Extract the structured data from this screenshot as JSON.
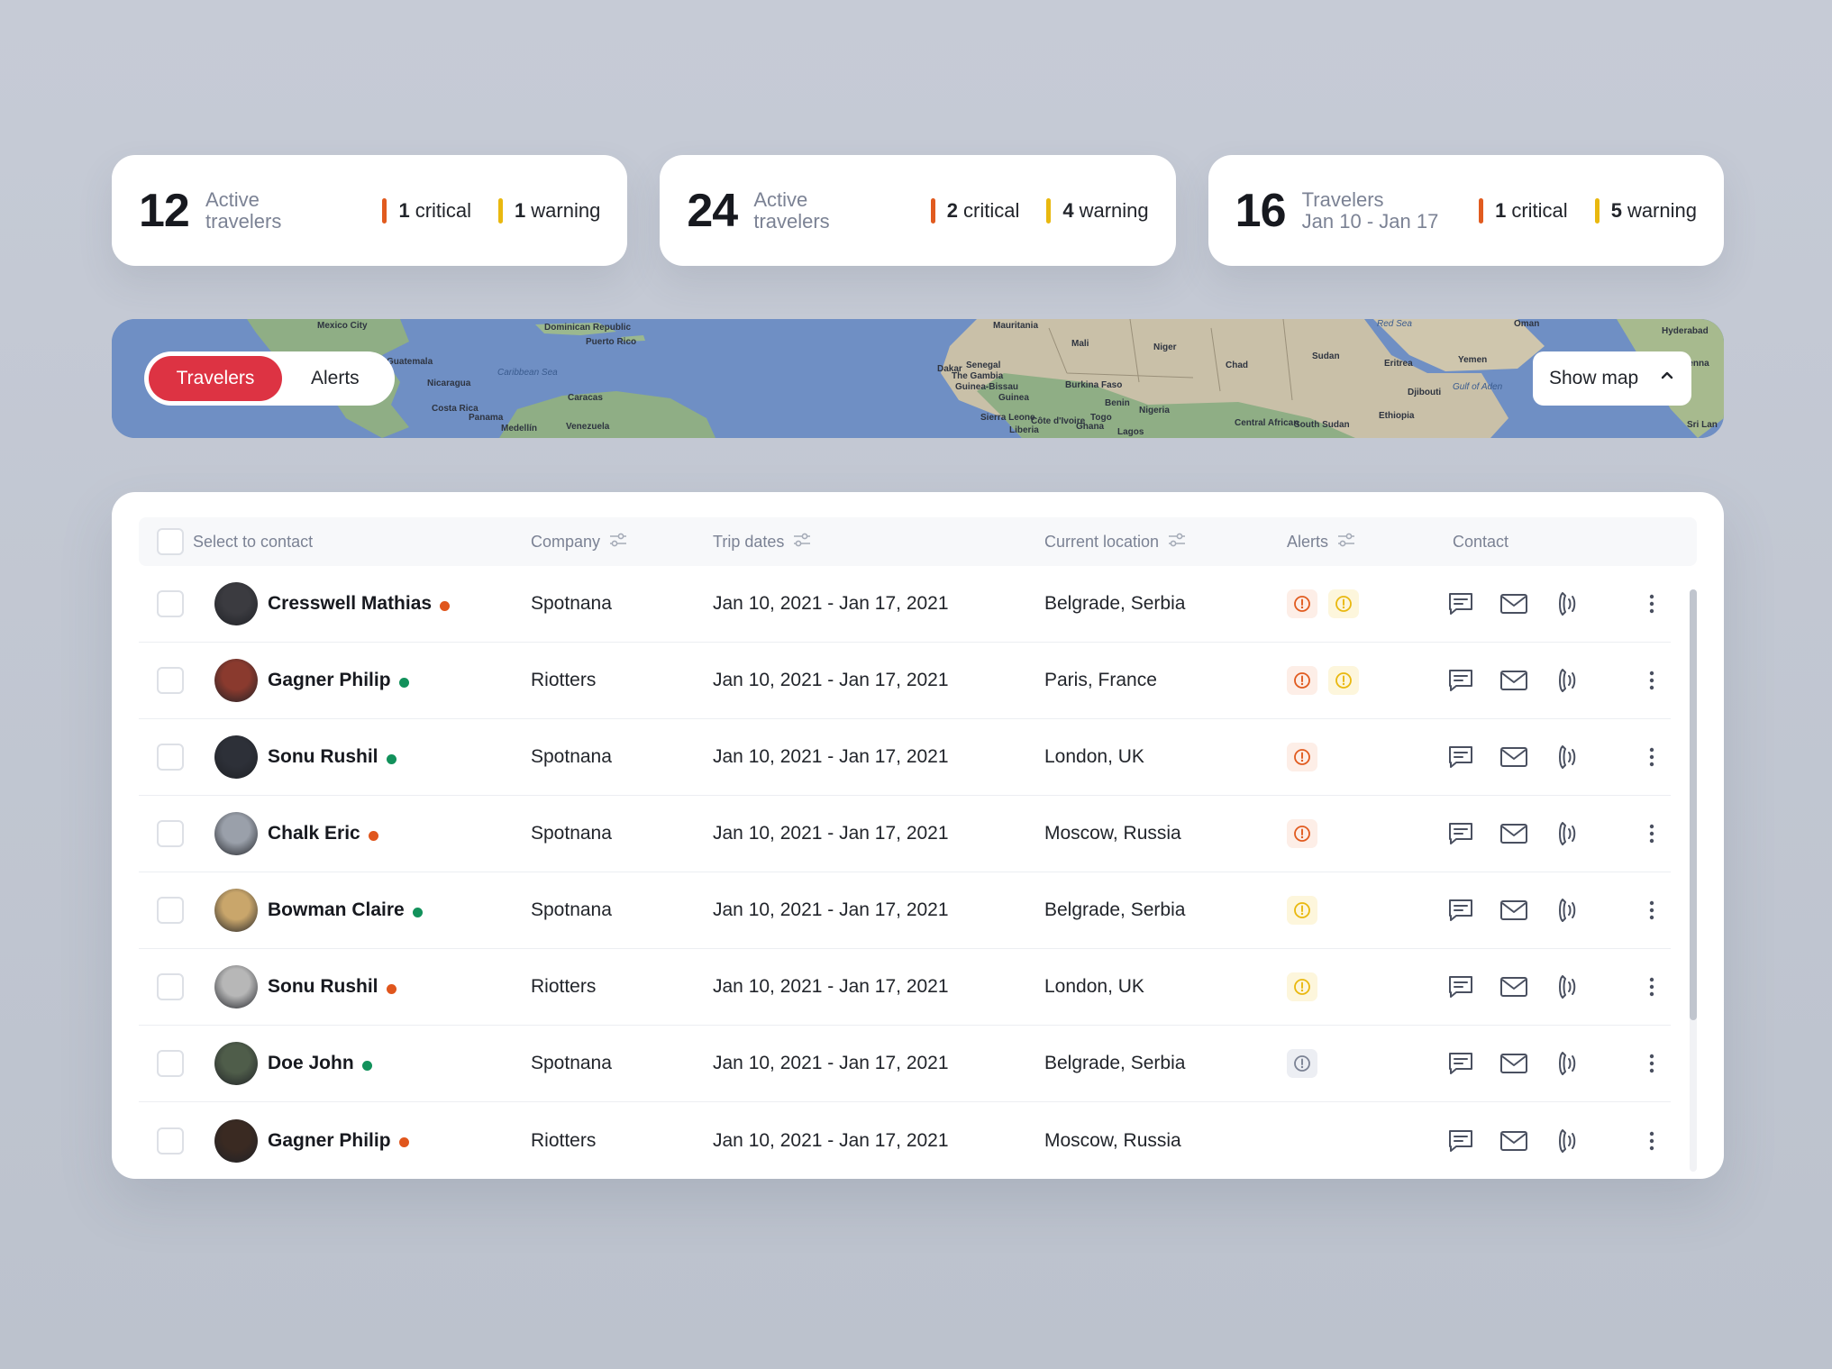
{
  "stats": [
    {
      "number": "12",
      "label_line1": "Active",
      "label_line2": "travelers",
      "critical_count": "1",
      "critical_label": "critical",
      "warning_count": "1",
      "warning_label": "warning"
    },
    {
      "number": "24",
      "label_line1": "Active",
      "label_line2": "travelers",
      "critical_count": "2",
      "critical_label": "critical",
      "warning_count": "4",
      "warning_label": "warning"
    },
    {
      "number": "16",
      "label_line1": "Travelers",
      "label_line2": "Jan 10 - Jan 17",
      "critical_count": "1",
      "critical_label": "critical",
      "warning_count": "5",
      "warning_label": "warning"
    }
  ],
  "map": {
    "labels": [
      "Mexico City",
      "Guatemala",
      "Nicaragua",
      "Costa Rica",
      "Panama",
      "Medellín",
      "Venezuela",
      "Caracas",
      "Dominican Republic",
      "Puerto Rico",
      "Caribbean Sea",
      "Mauritania",
      "Mali",
      "Niger",
      "Chad",
      "Sudan",
      "Eritrea",
      "Yemen",
      "Oman",
      "Senegal",
      "The Gambia",
      "Guinea-Bissau",
      "Guinea",
      "Sierra Leone",
      "Liberia",
      "Côte d'Ivoire",
      "Burkina Faso",
      "Ghana",
      "Togo",
      "Benin",
      "Nigeria",
      "Lagos",
      "Central African",
      "South Sudan",
      "Ethiopia",
      "Djibouti",
      "Gulf of Aden",
      "Hyderabad",
      "Chenna",
      "Sri Lan",
      "Dakar",
      "Red Sea"
    ],
    "toggle": {
      "travelers": "Travelers",
      "alerts": "Alerts",
      "active": "travelers"
    },
    "show_map_label": "Show map"
  },
  "table": {
    "headers": {
      "select": "Select to contact",
      "company": "Company",
      "trip_dates": "Trip dates",
      "location": "Current location",
      "alerts": "Alerts",
      "contact": "Contact"
    },
    "rows": [
      {
        "name": "Cresswell Mathias",
        "status": "orange",
        "company": "Spotnana",
        "dates": "Jan 10, 2021 - Jan 17, 2021",
        "location": "Belgrade, Serbia",
        "alerts": [
          "critical",
          "warning"
        ],
        "avatar_tone": "#3b3b40"
      },
      {
        "name": "Gagner Philip",
        "status": "green",
        "company": "Riotters",
        "dates": "Jan 10, 2021 - Jan 17, 2021",
        "location": "Paris, France",
        "alerts": [
          "critical",
          "warning"
        ],
        "avatar_tone": "#8a3a2e"
      },
      {
        "name": "Sonu Rushil",
        "status": "green",
        "company": "Spotnana",
        "dates": "Jan 10, 2021 - Jan 17, 2021",
        "location": "London, UK",
        "alerts": [
          "critical"
        ],
        "avatar_tone": "#2d3038"
      },
      {
        "name": "Chalk Eric",
        "status": "orange",
        "company": "Spotnana",
        "dates": "Jan 10, 2021 - Jan 17, 2021",
        "location": "Moscow, Russia",
        "alerts": [
          "critical"
        ],
        "avatar_tone": "#9aa0aa"
      },
      {
        "name": "Bowman Claire",
        "status": "green",
        "company": "Spotnana",
        "dates": "Jan 10, 2021 - Jan 17, 2021",
        "location": "Belgrade, Serbia",
        "alerts": [
          "warning"
        ],
        "avatar_tone": "#c9a66b"
      },
      {
        "name": "Sonu Rushil",
        "status": "orange",
        "company": "Riotters",
        "dates": "Jan 10, 2021 - Jan 17, 2021",
        "location": "London, UK",
        "alerts": [
          "warning"
        ],
        "avatar_tone": "#b7b7b7"
      },
      {
        "name": "Doe John",
        "status": "green",
        "company": "Spotnana",
        "dates": "Jan 10, 2021 - Jan 17, 2021",
        "location": "Belgrade, Serbia",
        "alerts": [
          "info"
        ],
        "avatar_tone": "#4f5d4a"
      },
      {
        "name": "Gagner Philip",
        "status": "orange",
        "company": "Riotters",
        "dates": "Jan 10, 2021 - Jan 17, 2021",
        "location": "Moscow, Russia",
        "alerts": [],
        "avatar_tone": "#3a2a22"
      }
    ]
  },
  "icons": {
    "filter": "filter-icon",
    "message": "message-icon",
    "mail": "mail-icon",
    "call": "call-icon",
    "more": "more-vertical-icon",
    "chevron": "chevron-up-icon",
    "alert": "alert-circle-icon"
  },
  "colors": {
    "critical": "#e15b1f",
    "warning": "#e9b80f",
    "info": "#7b8294",
    "status_green": "#12915b",
    "status_orange": "#e0561d",
    "accent": "#dd3343"
  }
}
